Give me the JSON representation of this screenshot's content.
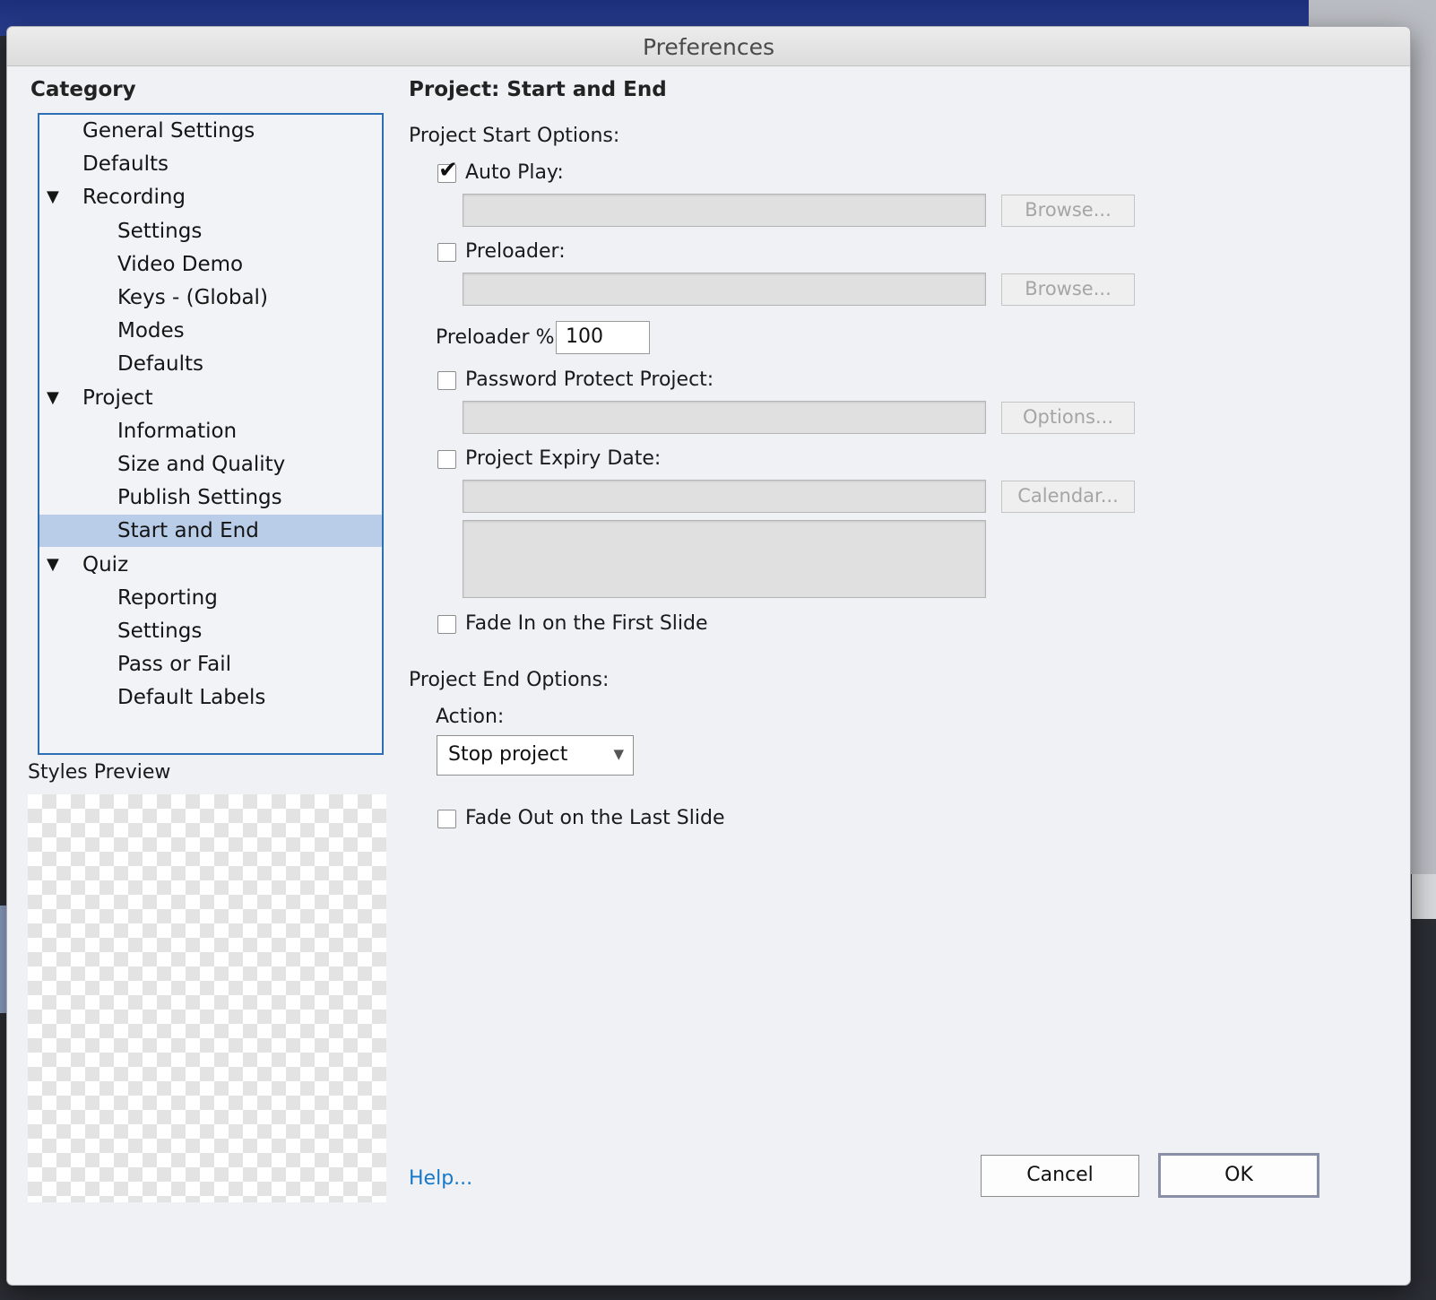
{
  "window": {
    "title": "Preferences"
  },
  "category": {
    "heading": "Category",
    "items": [
      {
        "label": "General Settings",
        "level": 0,
        "expandable": false,
        "selected": false
      },
      {
        "label": "Defaults",
        "level": 0,
        "expandable": false,
        "selected": false
      },
      {
        "label": "Recording",
        "level": 0,
        "expandable": true,
        "selected": false
      },
      {
        "label": "Settings",
        "level": 1,
        "expandable": false,
        "selected": false
      },
      {
        "label": "Video Demo",
        "level": 1,
        "expandable": false,
        "selected": false
      },
      {
        "label": "Keys - (Global)",
        "level": 1,
        "expandable": false,
        "selected": false
      },
      {
        "label": "Modes",
        "level": 1,
        "expandable": false,
        "selected": false
      },
      {
        "label": "Defaults",
        "level": 1,
        "expandable": false,
        "selected": false
      },
      {
        "label": "Project",
        "level": 0,
        "expandable": true,
        "selected": false
      },
      {
        "label": "Information",
        "level": 1,
        "expandable": false,
        "selected": false
      },
      {
        "label": "Size and Quality",
        "level": 1,
        "expandable": false,
        "selected": false
      },
      {
        "label": "Publish Settings",
        "level": 1,
        "expandable": false,
        "selected": false
      },
      {
        "label": "Start and End",
        "level": 1,
        "expandable": false,
        "selected": true
      },
      {
        "label": "Quiz",
        "level": 0,
        "expandable": true,
        "selected": false
      },
      {
        "label": "Reporting",
        "level": 1,
        "expandable": false,
        "selected": false
      },
      {
        "label": "Settings",
        "level": 1,
        "expandable": false,
        "selected": false
      },
      {
        "label": "Pass or Fail",
        "level": 1,
        "expandable": false,
        "selected": false
      },
      {
        "label": "Default Labels",
        "level": 1,
        "expandable": false,
        "selected": false
      }
    ],
    "expand_icon": "triangle-down-icon"
  },
  "styles_preview": {
    "label": "Styles Preview"
  },
  "panel": {
    "title": "Project: Start and End",
    "start_options": {
      "heading": "Project Start Options:",
      "auto_play": {
        "label": "Auto Play:",
        "checked": true,
        "value": "",
        "browse_label": "Browse..."
      },
      "preloader": {
        "label": "Preloader:",
        "checked": false,
        "value": "",
        "browse_label": "Browse..."
      },
      "preloader_percent": {
        "label": "Preloader %:",
        "value": "100"
      },
      "password": {
        "label": "Password Protect Project:",
        "checked": false,
        "value": "",
        "options_label": "Options..."
      },
      "expiry": {
        "label": "Project Expiry Date:",
        "checked": false,
        "value": "",
        "message": "",
        "calendar_label": "Calendar..."
      },
      "fade_in": {
        "label": "Fade In on the First Slide",
        "checked": false
      }
    },
    "end_options": {
      "heading": "Project End Options:",
      "action_label": "Action:",
      "action_value": "Stop project",
      "fade_out": {
        "label": "Fade Out on the Last Slide",
        "checked": false
      }
    }
  },
  "footer": {
    "help_label": "Help...",
    "cancel_label": "Cancel",
    "ok_label": "OK"
  },
  "colors": {
    "selection": "#b9cde9",
    "tree_border": "#2e6eb5",
    "link": "#1678c8",
    "dialog_bg": "#f0f1f5"
  }
}
